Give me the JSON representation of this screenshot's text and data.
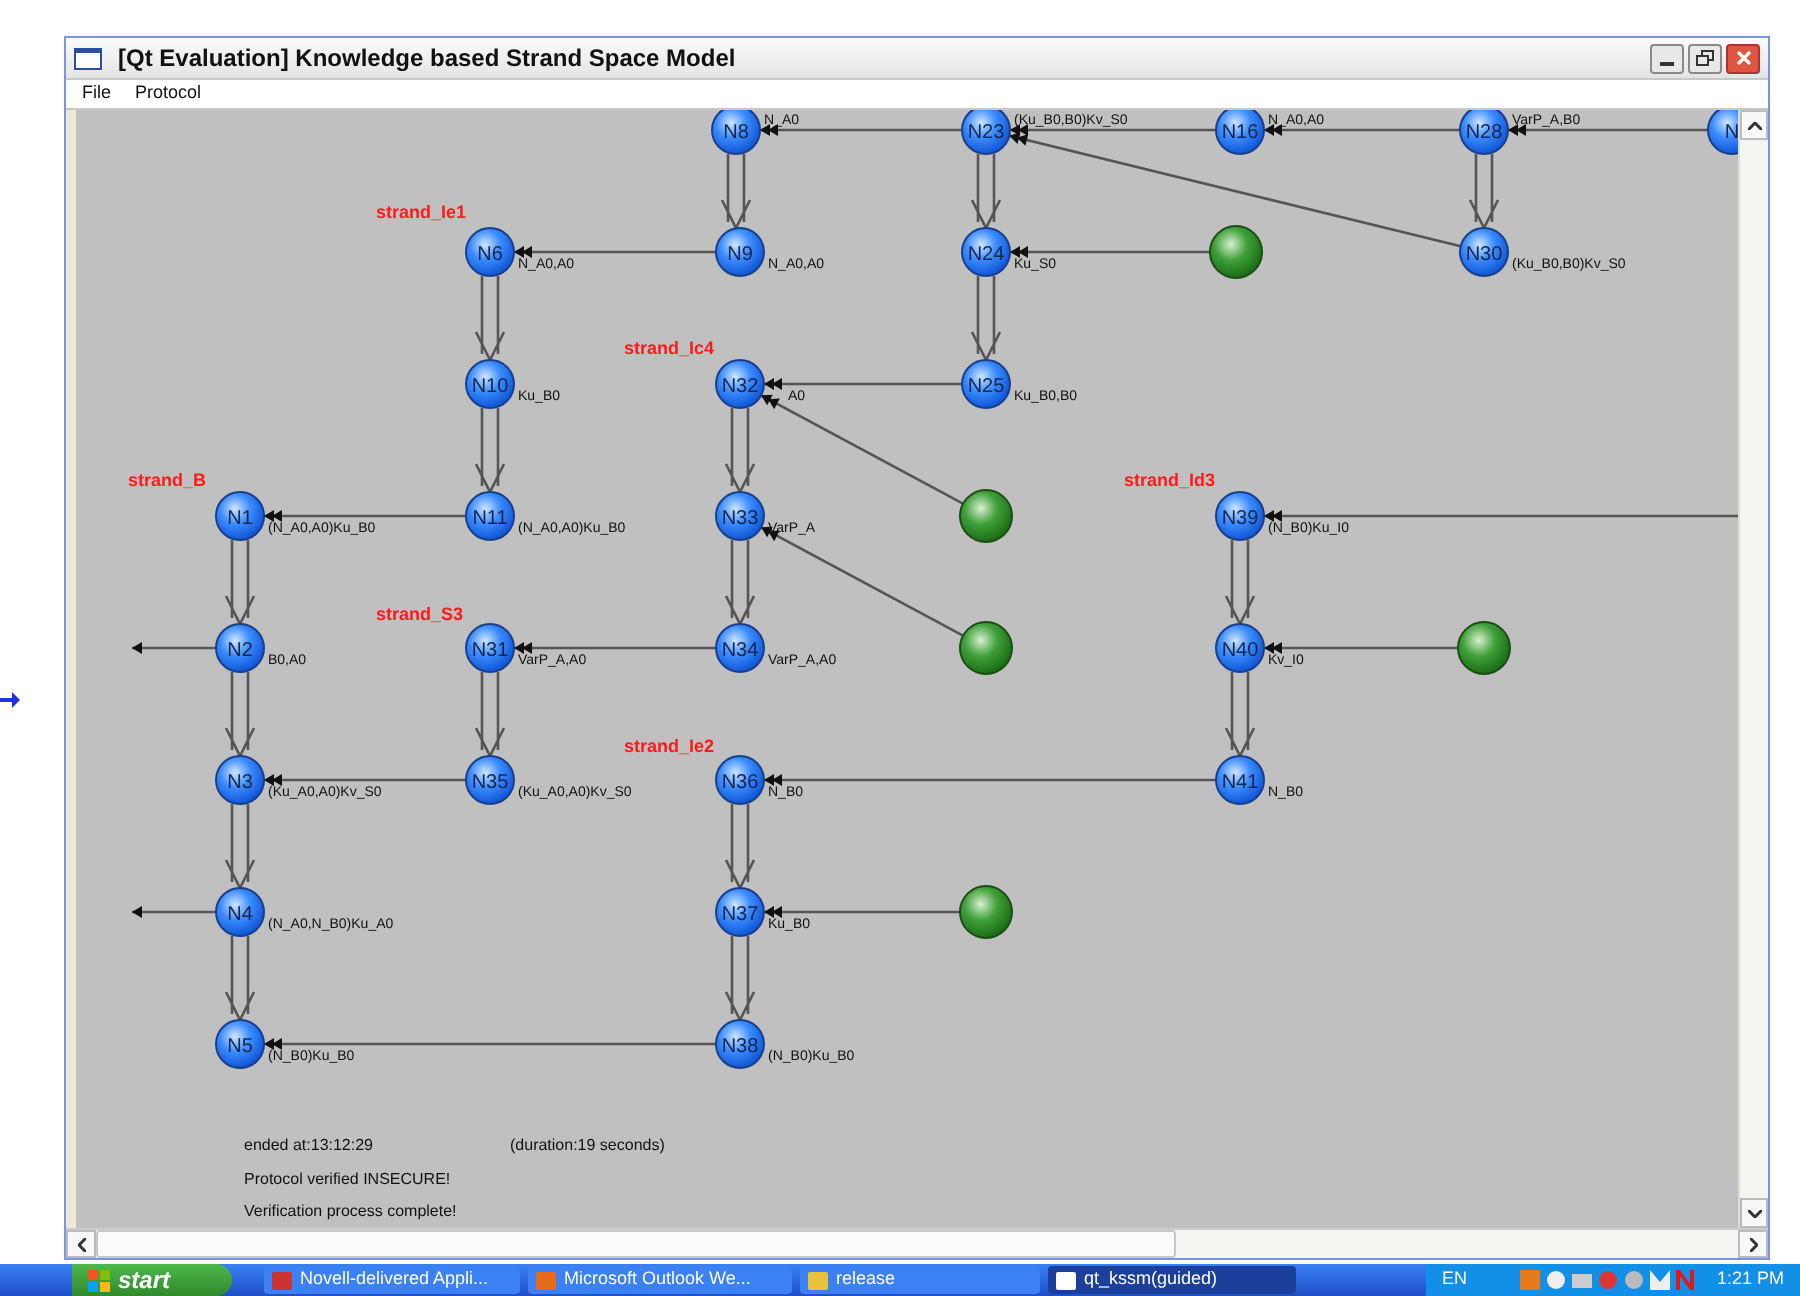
{
  "window": {
    "title": "[Qt Evaluation] Knowledge based Strand Space Model"
  },
  "menu": [
    "File",
    "Protocol"
  ],
  "strands": [
    {
      "title": "strand_Ie1"
    },
    {
      "title": "strand_Ic4"
    },
    {
      "title": "strand_B"
    },
    {
      "title": "strand_Id3"
    },
    {
      "title": "strand_S3"
    },
    {
      "title": "strand_Ie2"
    }
  ],
  "nodes": [
    {
      "kind": "regular",
      "name": "N8",
      "term": "N_A0"
    },
    {
      "kind": "regular",
      "name": "N23",
      "term": "(Ku_B0,B0)Kv_S0"
    },
    {
      "kind": "regular",
      "name": "N16",
      "term": "N_A0,A0"
    },
    {
      "kind": "regular",
      "name": "N28",
      "term": "VarP_A,B0"
    },
    {
      "kind": "regular",
      "name": "N"
    },
    {
      "kind": "regular",
      "name": "N6",
      "term": "N_A0,A0"
    },
    {
      "kind": "regular",
      "name": "N9",
      "term": "N_A0,A0"
    },
    {
      "kind": "regular",
      "name": "N24",
      "term": "Ku_S0"
    },
    {
      "kind": "penetrator"
    },
    {
      "kind": "regular",
      "name": "N30",
      "term": "(Ku_B0,B0)Kv_S0"
    },
    {
      "kind": "regular",
      "name": "N10",
      "term": "Ku_B0"
    },
    {
      "kind": "regular",
      "name": "N32",
      "term": "A0"
    },
    {
      "kind": "regular",
      "name": "N25",
      "term": "Ku_B0,B0"
    },
    {
      "kind": "regular",
      "name": "N1",
      "term": "(N_A0,A0)Ku_B0"
    },
    {
      "kind": "regular",
      "name": "N11",
      "term": "(N_A0,A0)Ku_B0"
    },
    {
      "kind": "regular",
      "name": "N33",
      "term": "VarP_A"
    },
    {
      "kind": "penetrator"
    },
    {
      "kind": "regular",
      "name": "N39",
      "term": "(N_B0)Ku_I0"
    },
    {
      "kind": "regular",
      "name": "N2",
      "term": "B0,A0"
    },
    {
      "kind": "regular",
      "name": "N31",
      "term": "VarP_A,A0"
    },
    {
      "kind": "regular",
      "name": "N34",
      "term": "VarP_A,A0"
    },
    {
      "kind": "penetrator"
    },
    {
      "kind": "regular",
      "name": "N40",
      "term": "Kv_I0"
    },
    {
      "kind": "penetrator"
    },
    {
      "kind": "regular",
      "name": "N3",
      "term": "(Ku_A0,A0)Kv_S0"
    },
    {
      "kind": "regular",
      "name": "N35",
      "term": "(Ku_A0,A0)Kv_S0"
    },
    {
      "kind": "regular",
      "name": "N36",
      "term": "N_B0"
    },
    {
      "kind": "regular",
      "name": "N41",
      "term": "N_B0"
    },
    {
      "kind": "regular",
      "name": "N4",
      "term": "(N_A0,N_B0)Ku_A0"
    },
    {
      "kind": "regular",
      "name": "N37",
      "term": "Ku_B0"
    },
    {
      "kind": "penetrator"
    },
    {
      "kind": "regular",
      "name": "N5",
      "term": "(N_B0)Ku_B0"
    },
    {
      "kind": "regular",
      "name": "N38",
      "term": "(N_B0)Ku_B0"
    }
  ],
  "log": {
    "ended": "ended at:13:12:29",
    "duration": "(duration:19 seconds)",
    "lines": [
      "Protocol verified INSECURE!",
      "Verification process complete!"
    ]
  },
  "taskbar": {
    "start": "start",
    "tasks": [
      {
        "label": "Novell-delivered Appli...",
        "selected": false
      },
      {
        "label": "Microsoft Outlook We...",
        "selected": false
      },
      {
        "label": "release",
        "selected": false
      },
      {
        "label": "qt_kssm(guided)",
        "selected": true
      }
    ],
    "language": "EN",
    "clock": "1:21 PM"
  }
}
